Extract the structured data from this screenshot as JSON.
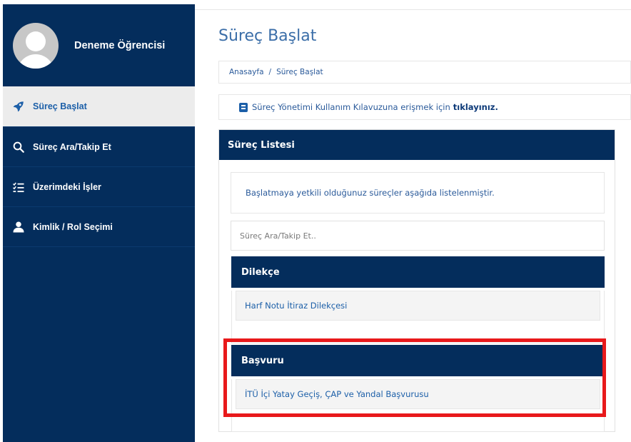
{
  "sidebar": {
    "user_name": "Deneme Öğrencisi",
    "items": [
      {
        "label": "Süreç Başlat",
        "icon": "rocket-icon",
        "active": true
      },
      {
        "label": "Süreç Ara/Takip Et",
        "icon": "search-icon",
        "active": false
      },
      {
        "label": "Üzerimdeki İşler",
        "icon": "task-list-icon",
        "active": false
      },
      {
        "label": "Kimlik / Rol Seçimi",
        "icon": "user-icon",
        "active": false
      }
    ]
  },
  "main": {
    "title": "Süreç Başlat",
    "breadcrumb": [
      "Anasayfa",
      "Süreç Başlat"
    ],
    "breadcrumb_sep": "/",
    "info": {
      "text": "Süreç Yönetimi Kullanım Kılavuzuna erişmek için",
      "link": "tıklayınız."
    },
    "panel": {
      "title": "Süreç Listesi",
      "notice": "Başlatmaya yetkili olduğunuz süreçler aşağıda listelenmiştir.",
      "search_placeholder": "Süreç Ara/Takip Et..",
      "groups": [
        {
          "title": "Dilekçe",
          "items": [
            "Harf Notu İtiraz Dilekçesi"
          ]
        },
        {
          "title": "Başvuru",
          "items": [
            "İTÜ İçi Yatay Geçiş, ÇAP ve Yandal Başvurusu"
          ]
        }
      ]
    }
  },
  "colors": {
    "navy": "#042d5c",
    "link": "#1c5fa8",
    "highlight": "#e8191b"
  }
}
